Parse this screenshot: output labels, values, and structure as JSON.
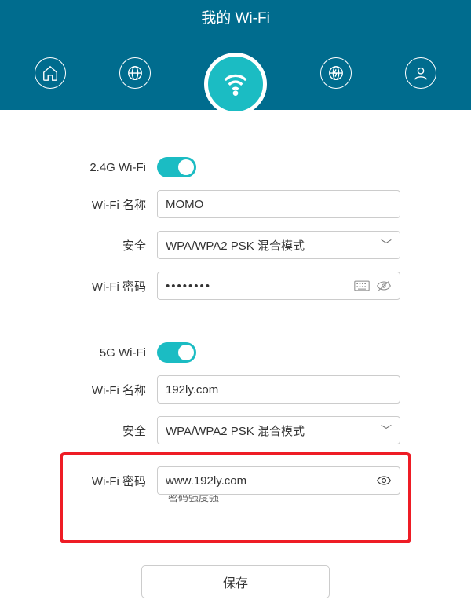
{
  "header": {
    "title": "我的 Wi-Fi"
  },
  "nav": {
    "home": "home",
    "internet": "internet",
    "wifi": "wifi",
    "advanced": "advanced",
    "user": "user"
  },
  "wifi24": {
    "title": "2.4G Wi-Fi",
    "enabled": true,
    "name_label": "Wi-Fi 名称",
    "name_value": "MOMO",
    "security_label": "安全",
    "security_value": "WPA/WPA2 PSK 混合模式",
    "password_label": "Wi-Fi 密码",
    "password_value": "••••••••"
  },
  "wifi5": {
    "title": "5G Wi-Fi",
    "enabled": true,
    "name_label": "Wi-Fi 名称",
    "name_value": "192ly.com",
    "security_label": "安全",
    "security_value": "WPA/WPA2 PSK 混合模式",
    "password_label": "Wi-Fi 密码",
    "password_value": "www.192ly.com",
    "strength_text": "密码强度强"
  },
  "buttons": {
    "save": "保存"
  }
}
